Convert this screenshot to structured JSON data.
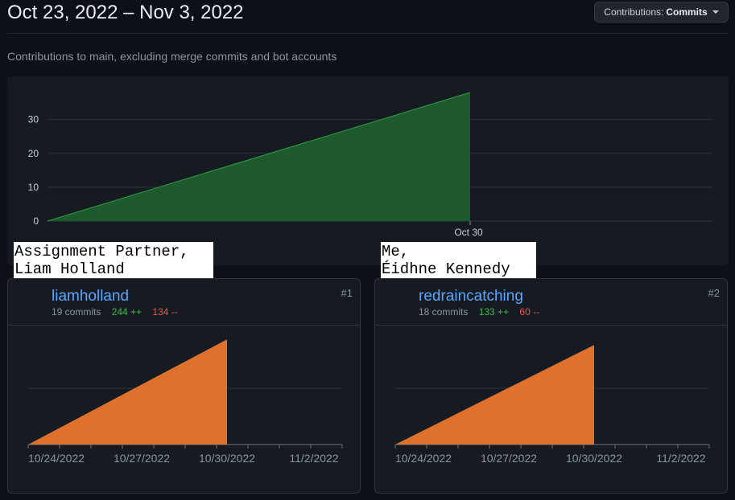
{
  "header": {
    "date_range": "Oct 23, 2022 – Nov 3, 2022",
    "contributions_prefix": "Contributions:",
    "contributions_value": "Commits"
  },
  "subtitle": "Contributions to main, excluding merge commits and bot accounts",
  "chart_data": [
    {
      "type": "area",
      "x": [
        "Oct 23",
        "Oct 30"
      ],
      "y": [
        0,
        38
      ],
      "xlabel": "",
      "ylabel": "",
      "x_tick_labels": [
        "Oct 30"
      ],
      "y_ticks": [
        0,
        10,
        20,
        30
      ],
      "ylim": [
        0,
        38
      ],
      "grid": true,
      "fill_color": "#1f5a2e",
      "line_color": "#2ea043"
    },
    {
      "type": "area",
      "x": [
        "10/24/2022",
        "10/30/2022"
      ],
      "y": [
        0,
        19
      ],
      "x_tick_labels": [
        "10/24/2022",
        "10/27/2022",
        "10/30/2022",
        "11/2/2022"
      ],
      "grid": true,
      "fill_color": "#e0712c"
    },
    {
      "type": "area",
      "x": [
        "10/24/2022",
        "10/30/2022"
      ],
      "y": [
        0,
        18
      ],
      "x_tick_labels": [
        "10/24/2022",
        "10/27/2022",
        "10/30/2022",
        "11/2/2022"
      ],
      "grid": true,
      "fill_color": "#e0712c"
    }
  ],
  "contributors": [
    {
      "username": "liamholland",
      "commits": "19 commits",
      "additions": "244 ++",
      "deletions": "134 --",
      "rank": "#1",
      "avatar_color": "#d04fc0"
    },
    {
      "username": "redraincatching",
      "commits": "18 commits",
      "additions": "133 ++",
      "deletions": "60 --",
      "rank": "#2",
      "avatar_color": "#a81c1c"
    }
  ],
  "annotations": {
    "left": "Assignment Partner,\nLiam Holland",
    "right": "Me,\nÉidhne Kennedy"
  }
}
